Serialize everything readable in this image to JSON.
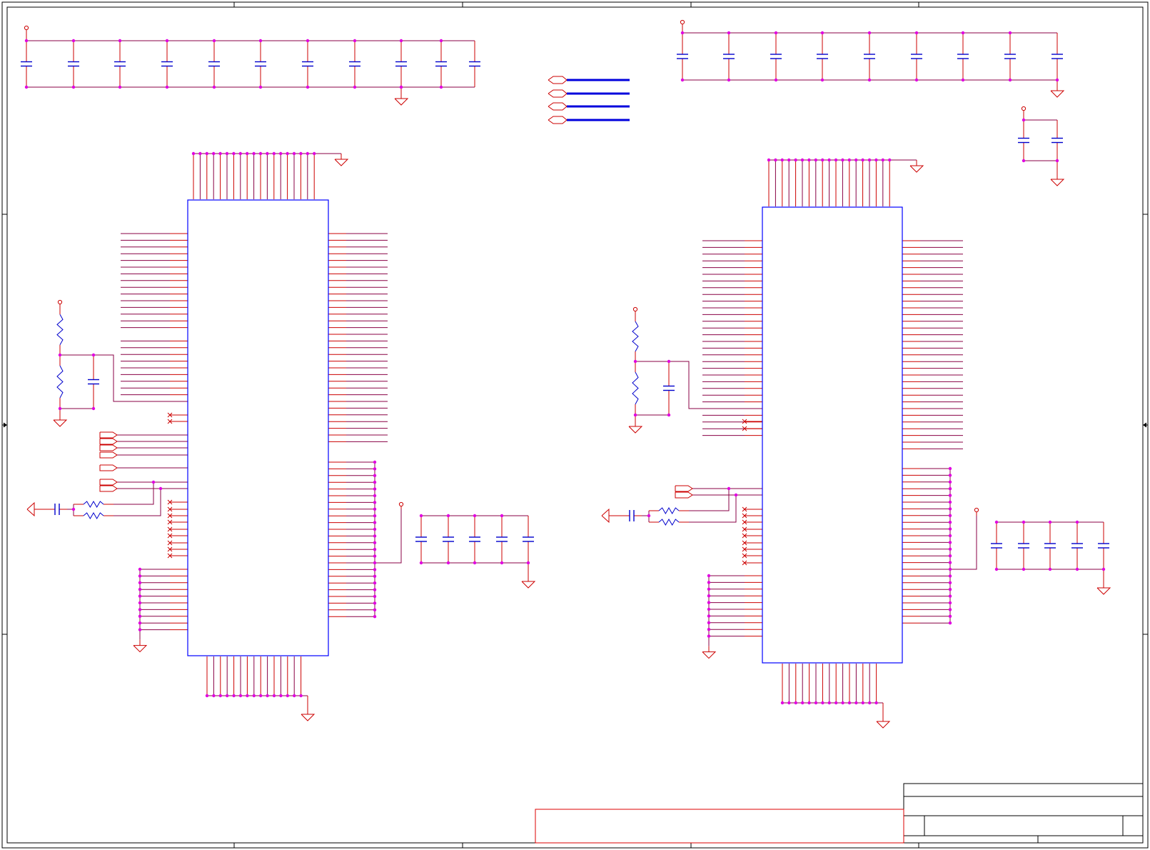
{
  "diagram": {
    "kind": "electrical-schematic",
    "colors": {
      "wire": "#cc0000",
      "net": "#880044",
      "junction": "#e000e0",
      "component": "#0000cc",
      "chip_outline": "#0000ff",
      "bus": "#0000dd",
      "border": "#000000",
      "title_block": "#000000",
      "red_box": "#dd0000"
    },
    "symbols": [
      "capacitor",
      "resistor",
      "ground",
      "power-port",
      "offpage-connector",
      "no-connect",
      "junction-dot",
      "ic-package"
    ],
    "text": []
  }
}
